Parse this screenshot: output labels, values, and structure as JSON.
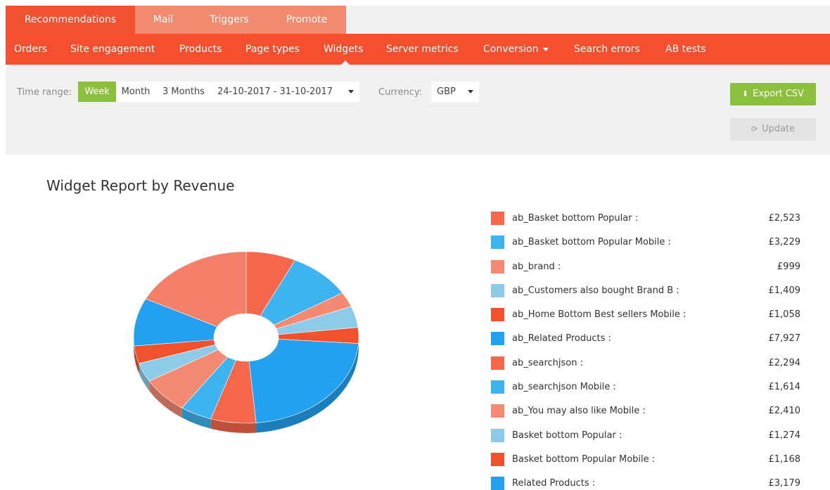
{
  "top_tabs": [
    {
      "label": "Recommendations",
      "active": true
    },
    {
      "label": "Mail",
      "active": false
    },
    {
      "label": "Triggers",
      "active": false
    },
    {
      "label": "Promote",
      "active": false
    }
  ],
  "sub_nav": {
    "items": [
      "Orders",
      "Site engagement",
      "Products",
      "Page types",
      "Widgets",
      "Server metrics",
      "Conversion",
      "Search errors",
      "AB tests"
    ],
    "active": "Widgets",
    "dropdown_item": "Conversion"
  },
  "filters": {
    "time_range_label": "Time range:",
    "ranges": [
      "Week",
      "Month",
      "3 Months"
    ],
    "selected_range": "Week",
    "date_range": "24-10-2017 - 31-10-2017",
    "currency_label": "Currency:",
    "currency": "GBP",
    "export_label": "Export CSV",
    "update_label": "Update"
  },
  "colors": {
    "brand_orange": "#f44f2e",
    "accent_green": "#8cbf3c"
  },
  "chart_data": {
    "type": "pie",
    "title": "Widget Report by Revenue",
    "donut": true,
    "legend_position": "right",
    "series": [
      {
        "name": "ab_Basket bottom Popular :",
        "value": 2523,
        "label": "£2,523",
        "color": "#f4674a"
      },
      {
        "name": "ab_Basket bottom Popular Mobile :",
        "value": 3229,
        "label": "£3,229",
        "color": "#3db3f0"
      },
      {
        "name": "ab_brand :",
        "value": 999,
        "label": "£999",
        "color": "#f48a72"
      },
      {
        "name": "ab_Customers also bought Brand B :",
        "value": 1409,
        "label": "£1,409",
        "color": "#8ecbe8"
      },
      {
        "name": "ab_Home Bottom Best sellers Mobile :",
        "value": 1058,
        "label": "£1,058",
        "color": "#f2512e"
      },
      {
        "name": "ab_Related Products :",
        "value": 7927,
        "label": "£7,927",
        "color": "#23a0f0"
      },
      {
        "name": "ab_searchjson :",
        "value": 2294,
        "label": "£2,294",
        "color": "#f4674a"
      },
      {
        "name": "ab_searchjson Mobile :",
        "value": 1614,
        "label": "£1,614",
        "color": "#3db3f0"
      },
      {
        "name": "ab_You may also like Mobile :",
        "value": 2410,
        "label": "£2,410",
        "color": "#f48a72"
      },
      {
        "name": "Basket bottom Popular :",
        "value": 1274,
        "label": "£1,274",
        "color": "#8ecbe8"
      },
      {
        "name": "Basket bottom Popular Mobile :",
        "value": 1168,
        "label": "£1,168",
        "color": "#f2512e"
      },
      {
        "name": "Related Products :",
        "value": 3179,
        "label": "£3,179",
        "color": "#23a0f0"
      },
      {
        "name": "",
        "value": 6200,
        "label": "",
        "color": "#f4806a"
      }
    ]
  }
}
